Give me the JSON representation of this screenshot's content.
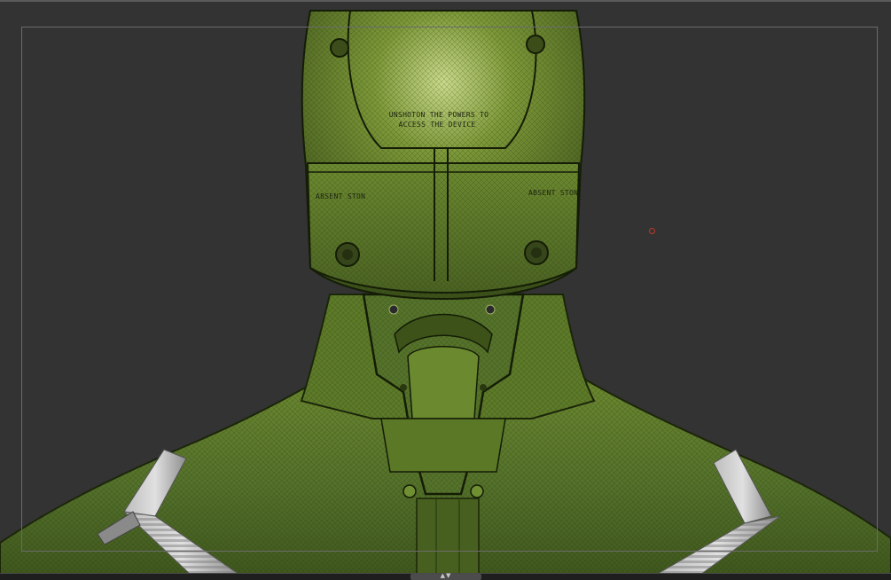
{
  "canvas": {
    "helmet_text_line1": "UNSHOTON THE POWERS TO",
    "helmet_text_line2": "ACCESS THE DEVICE",
    "visor_text_left": "ABSENT STON",
    "visor_text_right": "ABSENT STON",
    "model_color": "#5e7a2a",
    "wire_color": "#1e2a0c",
    "strap_color": "#9a9a9a",
    "background_color": "#333333",
    "cursor_color": "#c0392b"
  },
  "bottom_bar": {
    "handle_icon": "expand-arrows-icon",
    "handle_glyph": "▲▼"
  }
}
